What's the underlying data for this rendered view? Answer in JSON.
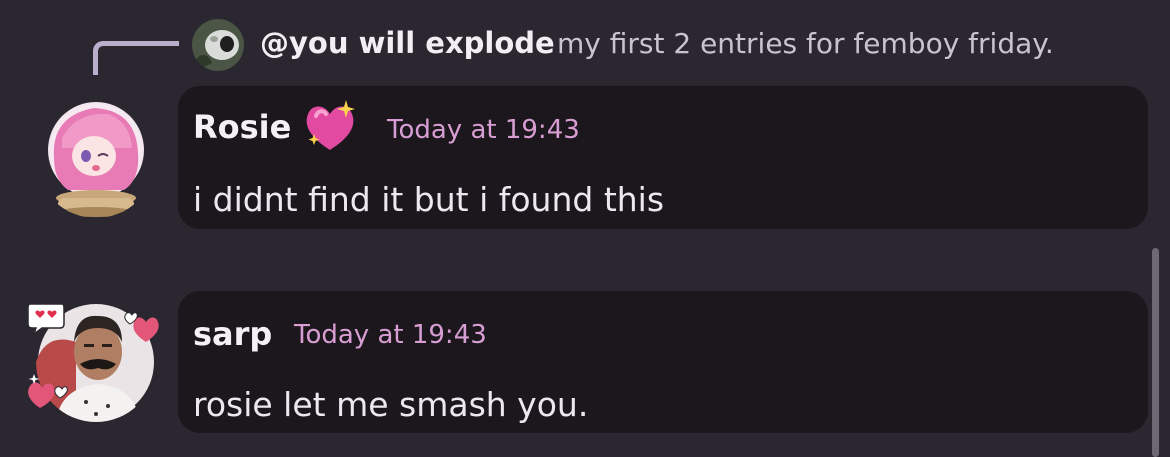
{
  "reply": {
    "author": "@you will explode",
    "text": "my first 2 entries for femboy friday."
  },
  "messages": [
    {
      "author": "Rosie",
      "author_emoji": "💖",
      "timestamp": "Today at 19:43",
      "text": "i didnt find it but i found this",
      "avatar_icon": "snow-globe-anime-avatar"
    },
    {
      "author": "sarp",
      "timestamp": "Today at 19:43",
      "text": "rosie let me smash you.",
      "avatar_icon": "hearts-decorated-avatar"
    }
  ],
  "colors": {
    "background": "#2b2730",
    "bubble": "#1b171d",
    "timestamp": "#d89ed3",
    "reply_line": "#b9aecb"
  }
}
